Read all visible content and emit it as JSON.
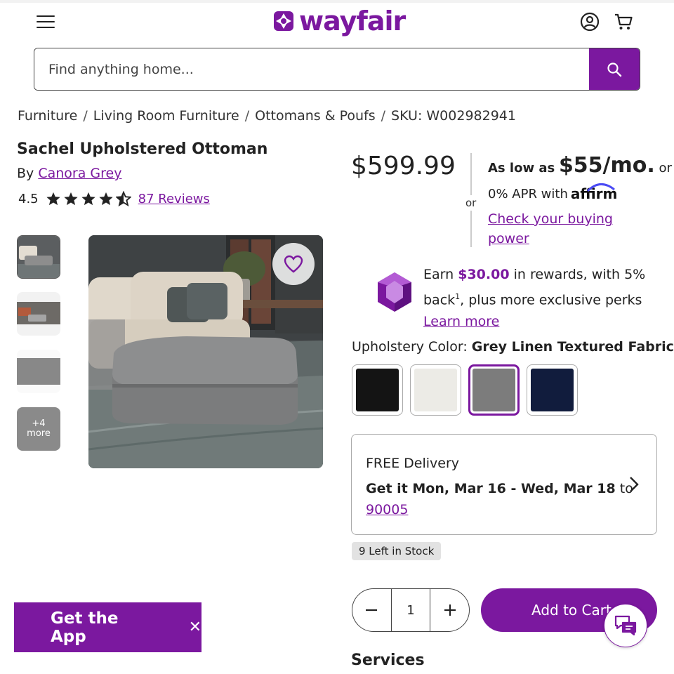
{
  "header": {
    "logo_text": "wayfair",
    "search_placeholder": "Find anything home..."
  },
  "breadcrumb": [
    "Furniture",
    "Living Room Furniture",
    "Ottomans & Poufs",
    "SKU: W002982941"
  ],
  "product": {
    "title": "Sachel Upholstered Ottoman",
    "by_label": "By",
    "brand": "Canora Grey",
    "rating": "4.5",
    "rating_stars": 4.5,
    "reviews": "87 Reviews",
    "thumb_more": "+4",
    "thumb_more_label": "more"
  },
  "pricing": {
    "price": "$599.99",
    "or": "or",
    "as_low_as": "As low as",
    "monthly": "$55/mo.",
    "monthly_or": "or",
    "apr": "0% APR with",
    "affirm": "affirm",
    "buying_power": "Check your buying power"
  },
  "rewards": {
    "earn": "Earn",
    "amount": "$30.00",
    "text1": "in rewards, with 5% back",
    "sup": "1",
    "text2": ", plus more exclusive perks",
    "learn_more": "Learn more"
  },
  "color": {
    "label": "Upholstery Color:",
    "selected": "Grey Linen Textured Fabric",
    "swatches": [
      {
        "color": "#141414",
        "selected": false
      },
      {
        "color": "#ecebe6",
        "selected": false
      },
      {
        "color": "#7c7c7c",
        "selected": true
      },
      {
        "color": "#111c3d",
        "selected": false
      }
    ]
  },
  "delivery": {
    "title": "FREE Delivery",
    "date": "Get it Mon, Mar 16 - Wed, Mar 18",
    "to": "to",
    "zip": "90005"
  },
  "stock": "9 Left in Stock",
  "quantity": "1",
  "add_to_cart": "Add to Cart",
  "services": "Services",
  "get_app": "Get the App",
  "colors": {
    "accent": "#7b189f"
  }
}
